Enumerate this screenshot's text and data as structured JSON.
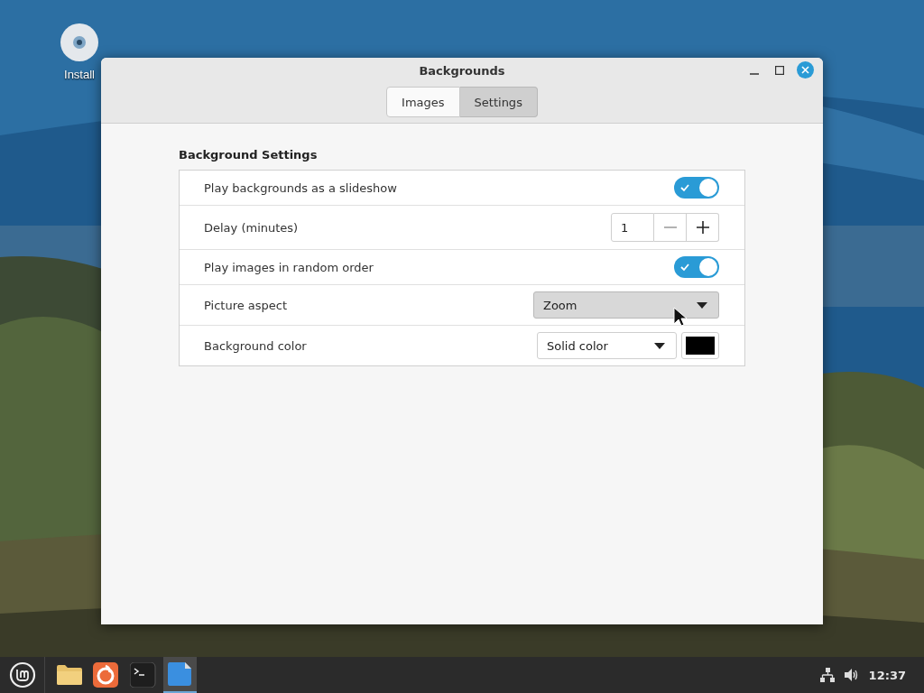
{
  "desktop": {
    "icons": [
      {
        "label": "Install"
      }
    ]
  },
  "window": {
    "title": "Backgrounds",
    "tabs": [
      {
        "label": "Images",
        "selected": false
      },
      {
        "label": "Settings",
        "selected": true
      }
    ]
  },
  "settings": {
    "title": "Background Settings",
    "rows": [
      {
        "kind": "switch",
        "label": "Play backgrounds as a slideshow",
        "on": true
      },
      {
        "kind": "spin",
        "label": "Delay (minutes)",
        "value": "1"
      },
      {
        "kind": "switch",
        "label": "Play images in random order",
        "on": true
      },
      {
        "kind": "combo",
        "label": "Picture aspect",
        "value": "Zoom",
        "highlighted": true
      },
      {
        "kind": "color",
        "label": "Background color",
        "value": "Solid color",
        "highlighted": false,
        "color": "#000000"
      }
    ]
  },
  "taskbar": {
    "launchers": [
      {
        "kind": "folder",
        "selected": false
      },
      {
        "kind": "browser",
        "selected": false
      },
      {
        "kind": "terminal",
        "selected": false
      },
      {
        "kind": "document",
        "selected": true
      }
    ],
    "clock": "12:37"
  }
}
